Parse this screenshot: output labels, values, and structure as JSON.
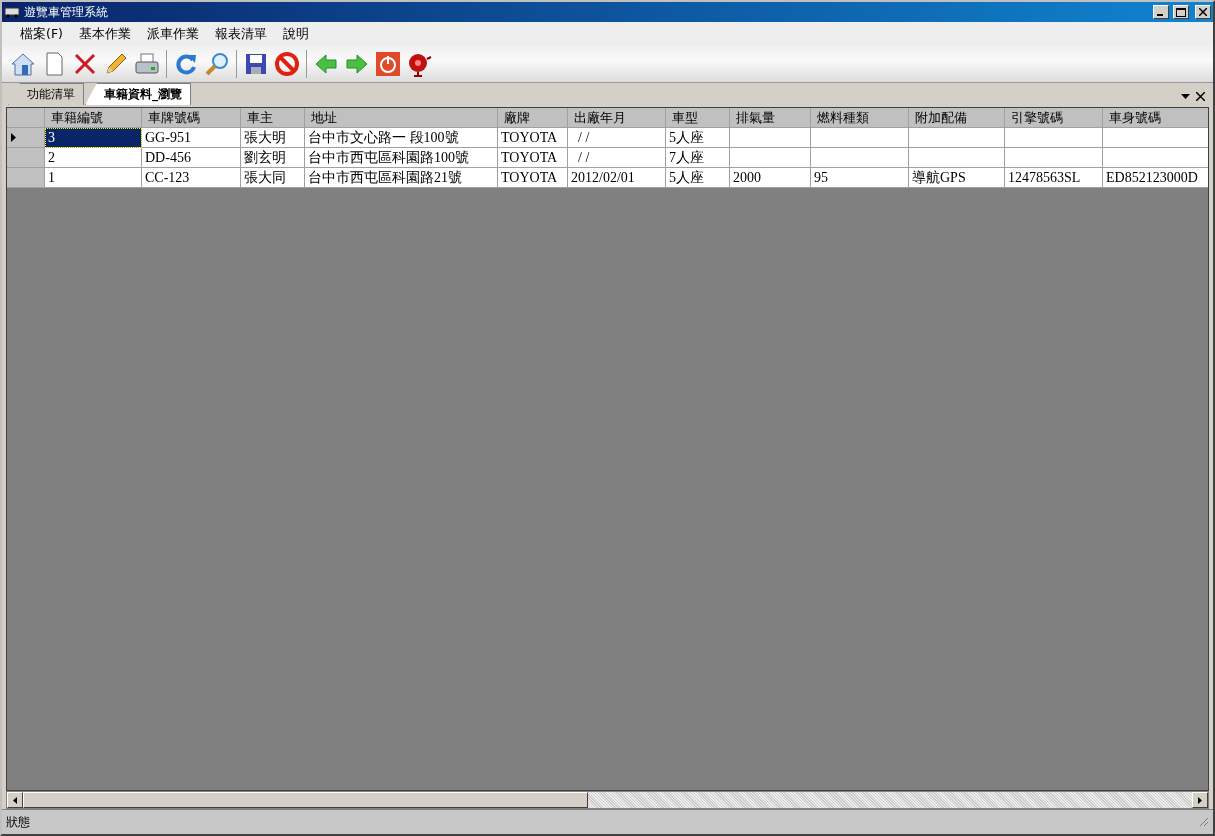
{
  "window": {
    "title": "遊覽車管理系統"
  },
  "menu": [
    "檔案(F)",
    "基本作業",
    "派車作業",
    "報表清單",
    "說明"
  ],
  "toolbar": [
    {
      "kind": "home"
    },
    {
      "kind": "document"
    },
    {
      "kind": "delete"
    },
    {
      "kind": "pencil"
    },
    {
      "kind": "print"
    },
    {
      "kind": "separator"
    },
    {
      "kind": "refresh"
    },
    {
      "kind": "search"
    },
    {
      "kind": "separator"
    },
    {
      "kind": "save"
    },
    {
      "kind": "cancel"
    },
    {
      "kind": "separator"
    },
    {
      "kind": "back"
    },
    {
      "kind": "forward"
    },
    {
      "kind": "power"
    },
    {
      "kind": "bell"
    }
  ],
  "tabs": [
    {
      "label": "功能清單",
      "selected": false
    },
    {
      "label": "車籍資料_瀏覽",
      "selected": true
    }
  ],
  "table": {
    "columns": [
      "車籍編號",
      "車牌號碼",
      "車主",
      "地址",
      "廠牌",
      "出廠年月",
      "車型",
      "排氣量",
      "燃料種類",
      "附加配備",
      "引擎號碼",
      "車身號碼"
    ],
    "rows": [
      {
        "selected": true,
        "cells": [
          "3",
          "GG-951",
          "張大明",
          "台中市文心路一 段100號",
          "TOYOTA",
          "  / /",
          "5人座",
          "",
          "",
          "",
          "",
          ""
        ]
      },
      {
        "selected": false,
        "cells": [
          "2",
          "DD-456",
          "劉玄明",
          "台中市西屯區科園路100號",
          "TOYOTA",
          "  / /",
          "7人座",
          "",
          "",
          "",
          "",
          ""
        ]
      },
      {
        "selected": false,
        "cells": [
          "1",
          "CC-123",
          "張大同",
          "台中市西屯區科園路21號",
          "TOYOTA",
          "2012/02/01",
          "5人座",
          "2000",
          "95",
          "導航GPS",
          "12478563SL",
          "ED852123000D"
        ]
      }
    ]
  },
  "status_bar": "狀態"
}
